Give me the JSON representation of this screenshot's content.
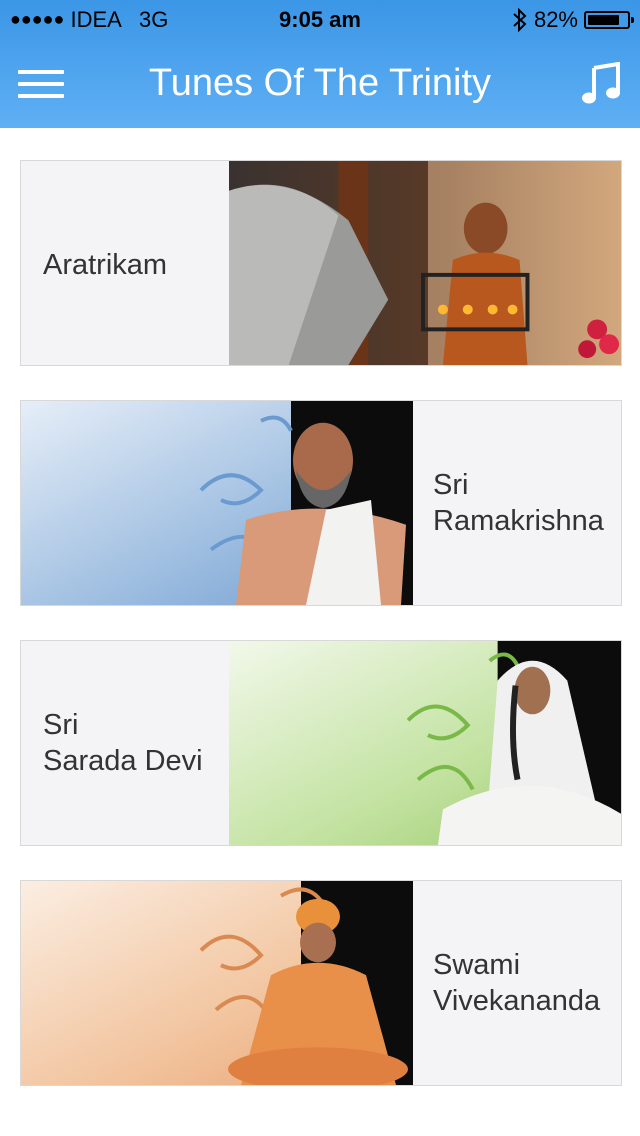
{
  "status_bar": {
    "carrier": "IDEA",
    "network": "3G",
    "time": "9:05 am",
    "battery_percent": "82%",
    "battery_level": 0.82
  },
  "header": {
    "title": "Tunes Of The Trinity",
    "menu_icon": "hamburger-menu-icon",
    "music_icon": "music-note-icon",
    "color": "#4aa3ee"
  },
  "cards": [
    {
      "line1": "Aratrikam",
      "line2": ""
    },
    {
      "line1": "Sri",
      "line2": "Ramakrishna"
    },
    {
      "line1": "Sri",
      "line2": "Sarada Devi"
    },
    {
      "line1": "Swami",
      "line2": "Vivekananda"
    }
  ]
}
